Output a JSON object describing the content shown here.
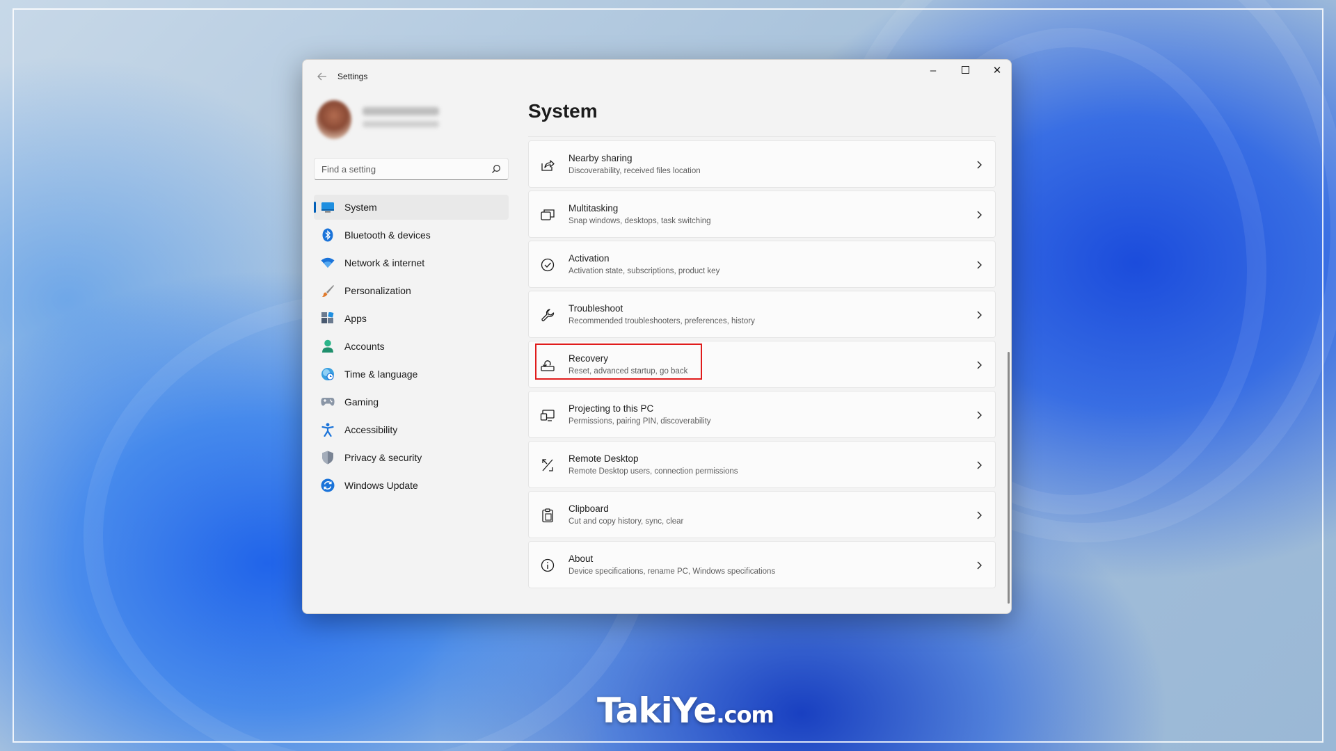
{
  "window": {
    "title": "Settings",
    "controls": {
      "minimize": "–",
      "close": "✕"
    }
  },
  "search": {
    "placeholder": "Find a setting"
  },
  "sidebar": {
    "items": [
      {
        "label": "System",
        "icon": "system-icon",
        "selected": true
      },
      {
        "label": "Bluetooth & devices",
        "icon": "bluetooth-icon"
      },
      {
        "label": "Network & internet",
        "icon": "wifi-icon"
      },
      {
        "label": "Personalization",
        "icon": "brush-icon"
      },
      {
        "label": "Apps",
        "icon": "apps-icon"
      },
      {
        "label": "Accounts",
        "icon": "person-icon"
      },
      {
        "label": "Time & language",
        "icon": "globe-clock-icon"
      },
      {
        "label": "Gaming",
        "icon": "controller-icon"
      },
      {
        "label": "Accessibility",
        "icon": "accessibility-icon"
      },
      {
        "label": "Privacy & security",
        "icon": "shield-icon"
      },
      {
        "label": "Windows Update",
        "icon": "update-icon"
      }
    ]
  },
  "main": {
    "title": "System",
    "cards": [
      {
        "title": "Nearby sharing",
        "desc": "Discoverability, received files location",
        "icon": "share-icon"
      },
      {
        "title": "Multitasking",
        "desc": "Snap windows, desktops, task switching",
        "icon": "multitasking-icon"
      },
      {
        "title": "Activation",
        "desc": "Activation state, subscriptions, product key",
        "icon": "check-circle-icon"
      },
      {
        "title": "Troubleshoot",
        "desc": "Recommended troubleshooters, preferences, history",
        "icon": "wrench-icon"
      },
      {
        "title": "Recovery",
        "desc": "Reset, advanced startup, go back",
        "icon": "recovery-icon",
        "highlighted": true
      },
      {
        "title": "Projecting to this PC",
        "desc": "Permissions, pairing PIN, discoverability",
        "icon": "projecting-icon"
      },
      {
        "title": "Remote Desktop",
        "desc": "Remote Desktop users, connection permissions",
        "icon": "remote-desktop-icon"
      },
      {
        "title": "Clipboard",
        "desc": "Cut and copy history, sync, clear",
        "icon": "clipboard-icon"
      },
      {
        "title": "About",
        "desc": "Device specifications, rename PC, Windows specifications",
        "icon": "info-icon"
      }
    ]
  },
  "watermark": {
    "brand": "TakiYe",
    "suffix": "com"
  },
  "colors": {
    "accent": "#005fb8",
    "highlight": "#e01b1b"
  }
}
